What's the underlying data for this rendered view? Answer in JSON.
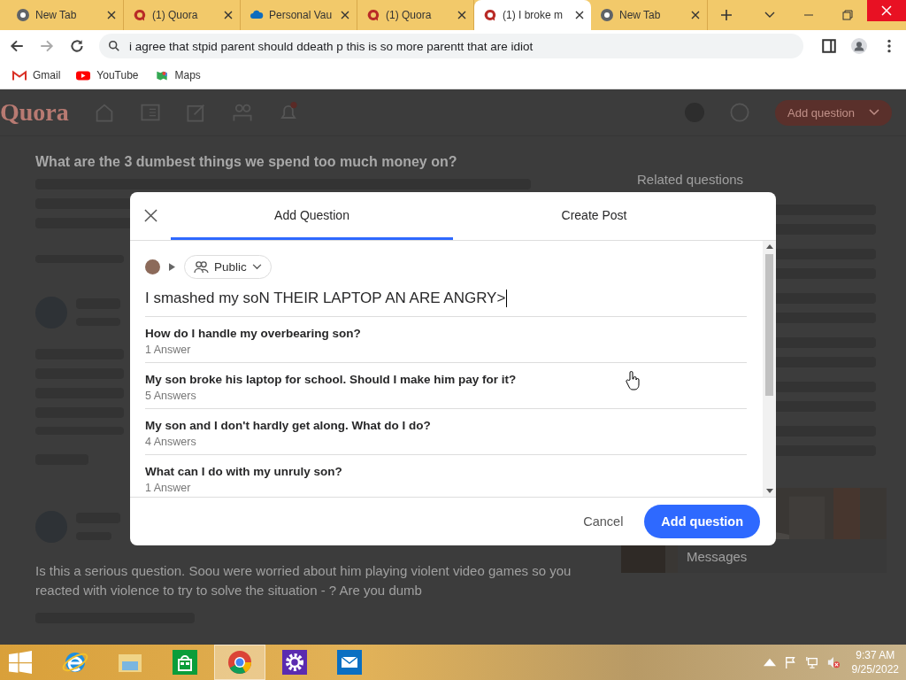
{
  "browser": {
    "tabs": [
      {
        "title": "New Tab",
        "kind": "chrome",
        "selected": false
      },
      {
        "title": "(1) Quora",
        "kind": "quora",
        "selected": false
      },
      {
        "title": "Personal Vau",
        "kind": "cloud",
        "selected": false
      },
      {
        "title": "(1) Quora",
        "kind": "quora",
        "selected": false
      },
      {
        "title": "(1) I broke m",
        "kind": "quora",
        "selected": true
      },
      {
        "title": "New Tab",
        "kind": "chrome",
        "selected": false
      }
    ],
    "address": "i agree that stpid parent should ddeath p this is so more parentt that are idiot",
    "bookmarks": [
      {
        "label": "Gmail",
        "kind": "gmail"
      },
      {
        "label": "YouTube",
        "kind": "youtube"
      },
      {
        "label": "Maps",
        "kind": "maps"
      }
    ]
  },
  "page": {
    "logo": "Quora",
    "header_button": "Add question",
    "question_title": "What are the 3 dumbest things we spend too much money on?",
    "answer_text": "Is this a serious question. Soou were worried about him playing violent video games so you reacted with violence to try to solve the situation - ? Are you dumb",
    "related_heading": "Related questions",
    "messages_label": "Messages"
  },
  "modal": {
    "tabs": [
      {
        "label": "Add Question",
        "selected": true
      },
      {
        "label": "Create Post",
        "selected": false
      }
    ],
    "audience": "Public",
    "question": "I smashed my soN THEIR LAPTOP AN ARE ANGRY>",
    "suggestions": [
      {
        "title": "How do I handle my overbearing son?",
        "answers": "1 Answer"
      },
      {
        "title": "My son broke his laptop for school. Should I make him pay for it?",
        "answers": "5 Answers"
      },
      {
        "title": "My son and I don't hardly get along. What do I do?",
        "answers": "4 Answers"
      },
      {
        "title": "What can I do with my unruly son?",
        "answers": "1 Answer"
      }
    ],
    "cancel": "Cancel",
    "submit": "Add question"
  },
  "taskbar": {
    "apps": [
      {
        "kind": "ie",
        "selected": false
      },
      {
        "kind": "files",
        "selected": false
      },
      {
        "kind": "store",
        "selected": false
      },
      {
        "kind": "chrome",
        "selected": true
      },
      {
        "kind": "settings",
        "selected": false
      },
      {
        "kind": "mail",
        "selected": false
      }
    ],
    "time": "9:37 AM",
    "date": "9/25/2022"
  }
}
